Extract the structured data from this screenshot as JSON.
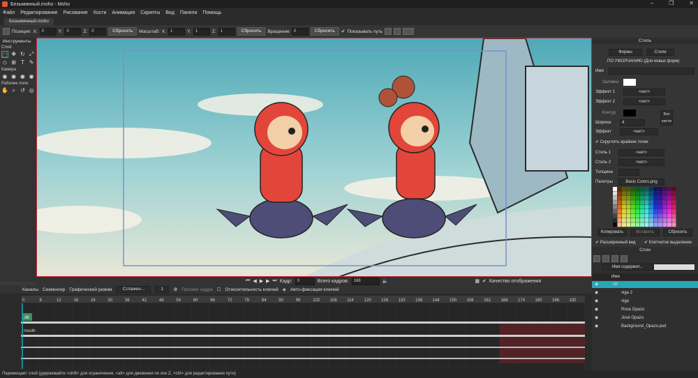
{
  "window": {
    "title": "Безымянный.moho - Moho"
  },
  "menu": [
    "Файл",
    "Редактирование",
    "Рисование",
    "Кости",
    "Анимация",
    "Скрипты",
    "Вид",
    "Панели",
    "Помощь"
  ],
  "doc_tab": "Безымянный.moho",
  "options": {
    "position_label": "Позиция:",
    "x_label": "X:",
    "x_val": "0",
    "y_label": "Y:",
    "y_val": "0",
    "z_label": "Z:",
    "z_val": "0",
    "reset1": "Сбросить",
    "scale_label": "Масштаб:",
    "sx_label": "X:",
    "sx_val": "1",
    "sy_label": "Y:",
    "sy_val": "1",
    "sz_label": "Z:",
    "sz_val": "1",
    "reset2": "Сбросить",
    "rotation_label": "Вращение",
    "rot_val": "0",
    "reset3": "Сбросить",
    "show_path": "Показывать путь"
  },
  "tools": {
    "header": "Инструменты",
    "layer": "Слой",
    "camera": "Камера",
    "workspace": "Рабочее поле"
  },
  "canvas_bar": {
    "frame_label": "Кадр:",
    "frame_val": "0",
    "total_label": "Всего кадров:",
    "total_val": "168",
    "quality": "Качество отображения"
  },
  "timeline": {
    "tabs": [
      "Каналы",
      "Секвенсер",
      "Графический режим"
    ],
    "smoothing": "Сглажен...",
    "one": "1",
    "onion": "Просвет кадра",
    "relative_keys": "Относительность ключей",
    "auto_freeze": "Авто-фиксация ключей",
    "ruler": [
      "0",
      "6",
      "12",
      "18",
      "24",
      "30",
      "36",
      "42",
      "48",
      "54",
      "60",
      "66",
      "72",
      "78",
      "84",
      "90",
      "96",
      "102",
      "108",
      "114",
      "120",
      "126",
      "132",
      "138",
      "144",
      "150",
      "156",
      "162",
      "168",
      "174",
      "180",
      "186",
      "192"
    ],
    "seconds": [
      "1",
      "2",
      "3",
      "4",
      "5",
      "6",
      "7",
      "8"
    ],
    "all_label": "All",
    "mouth_label": "mouth"
  },
  "style": {
    "header": "Стиль",
    "shapes_btn": "Формы",
    "styles_btn": "Стили",
    "default_note": "ПО УМОЛЧАНИЮ (Для новых форм)",
    "name_label": "Имя",
    "fill_label": "Заливка",
    "effect1": "Эффект 1",
    "effect2": "Эффект 2",
    "none": "<нет>",
    "stroke_label": "Контур",
    "width_label": "Ширина",
    "width_val": "4",
    "no_brush": "Без кисти",
    "effect": "Эффект",
    "round_caps": "Скруглять крайние точки",
    "style1": "Стиль 1",
    "style2": "Стиль 2",
    "thickness": "Толщина",
    "palettes": "Палитры",
    "palette_name": "Basic Colors.png",
    "copy": "Копировать",
    "paste": "Вставить",
    "reset": "Сбросить",
    "extended": "Расширенный вид",
    "checker": "Клетчатое выделение"
  },
  "layers": {
    "header": "Слои",
    "filter": "Имя содержит...",
    "col_name": "Имя",
    "items": [
      {
        "name": "All",
        "indent": 0
      },
      {
        "name": "viga 2",
        "indent": 1
      },
      {
        "name": "viga",
        "indent": 1
      },
      {
        "name": "Rosa Opazo",
        "indent": 1
      },
      {
        "name": "José Opazo",
        "indent": 1
      },
      {
        "name": "Background_Opazo.psd",
        "indent": 1
      }
    ]
  },
  "status": "Перемещает слой (удерживайте <shift> для ограничения, <alt> для движения по оси Z, <ctrl> для редактирования пути)",
  "colors": {
    "accent": "#27a7b5",
    "selection": "#c0283a",
    "canvas_frame": "#d02b3a",
    "camera_frame": "#7c8fc8"
  }
}
